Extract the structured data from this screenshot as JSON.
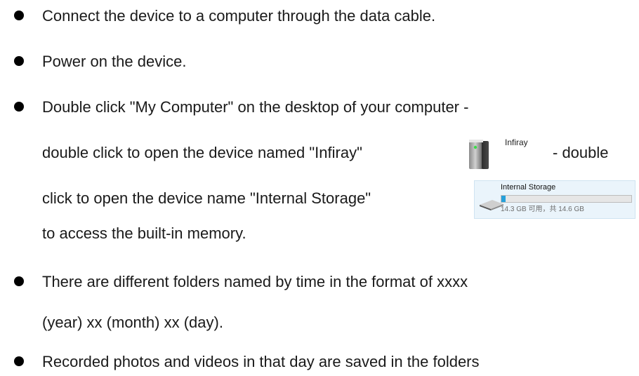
{
  "bullets": [
    {
      "lines": [
        "Connect the device to a computer through the data cable."
      ]
    },
    {
      "lines": [
        "Power on the device."
      ]
    },
    {
      "lines": [
        "Double click \"My Computer\" on the desktop of your computer -",
        "double click to open the device named \"Infiray\"",
        "- double",
        "click to open the device name \"Internal Storage\"",
        "to access the built-in memory."
      ]
    },
    {
      "lines": [
        "There are different folders named by time in the format of xxxx",
        "(year) xx (month) xx (day)."
      ]
    },
    {
      "lines": [
        "Recorded photos and videos in that day are saved in the folders"
      ]
    }
  ],
  "infiray_device": {
    "label": "Infiray",
    "icon": "usb-device-icon"
  },
  "internal_storage": {
    "name": "Internal Storage",
    "info": "14.3 GB 可用，共 14.6 GB",
    "used_fraction": 0.021,
    "icon": "drive-icon",
    "bar_color": "#26a0da"
  }
}
